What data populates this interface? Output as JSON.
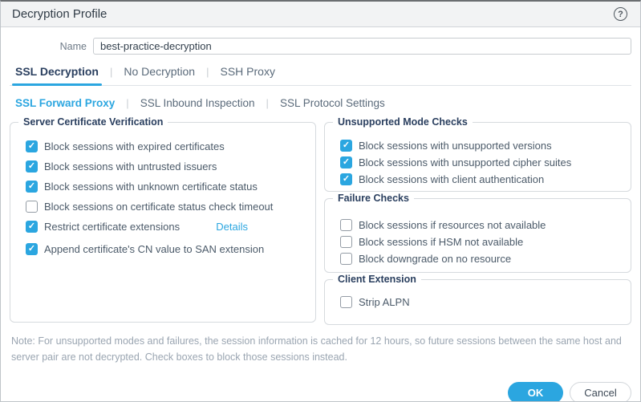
{
  "dialog": {
    "title": "Decryption Profile",
    "help_icon": "circled-question-mark"
  },
  "name_field": {
    "label": "Name",
    "value": "best-practice-decryption"
  },
  "tabs": [
    {
      "label": "SSL Decryption",
      "active": true
    },
    {
      "label": "No Decryption",
      "active": false
    },
    {
      "label": "SSH Proxy",
      "active": false
    }
  ],
  "subtabs": [
    {
      "label": "SSL Forward Proxy",
      "active": true
    },
    {
      "label": "SSL Inbound Inspection",
      "active": false
    },
    {
      "label": "SSL Protocol Settings",
      "active": false
    }
  ],
  "sections": {
    "server_cert": {
      "legend": "Server Certificate Verification",
      "items": [
        {
          "label": "Block sessions with expired certificates",
          "checked": true
        },
        {
          "label": "Block sessions with untrusted issuers",
          "checked": true
        },
        {
          "label": "Block sessions with unknown certificate status",
          "checked": true
        },
        {
          "label": "Block sessions on certificate status check timeout",
          "checked": false
        },
        {
          "label": "Restrict certificate extensions",
          "checked": true,
          "link": "Details"
        },
        {
          "label": "Append certificate's CN value to SAN extension",
          "checked": true
        }
      ]
    },
    "unsupported": {
      "legend": "Unsupported Mode Checks",
      "items": [
        {
          "label": "Block sessions with unsupported versions",
          "checked": true
        },
        {
          "label": "Block sessions with unsupported cipher suites",
          "checked": true
        },
        {
          "label": "Block sessions with client authentication",
          "checked": true
        }
      ]
    },
    "failure": {
      "legend": "Failure Checks",
      "items": [
        {
          "label": "Block sessions if resources not available",
          "checked": false
        },
        {
          "label": "Block sessions if HSM not available",
          "checked": false
        },
        {
          "label": "Block downgrade on no resource",
          "checked": false
        }
      ]
    },
    "client_ext": {
      "legend": "Client Extension",
      "items": [
        {
          "label": "Strip ALPN",
          "checked": false
        }
      ]
    }
  },
  "note": "Note: For unsupported modes and failures, the session information is cached for 12 hours, so future sessions between the same host and server pair are not decrypted. Check boxes to block those sessions instead.",
  "footer": {
    "ok_label": "OK",
    "cancel_label": "Cancel"
  },
  "colors": {
    "accent_blue": "#2BA6E0",
    "active_tab_text": "#2A3F5F",
    "label_text": "#4B5A69",
    "note_text": "#9AA5B1",
    "titlebar_bg": "#F2F3F4",
    "fieldset_border": "#D6DADE"
  }
}
